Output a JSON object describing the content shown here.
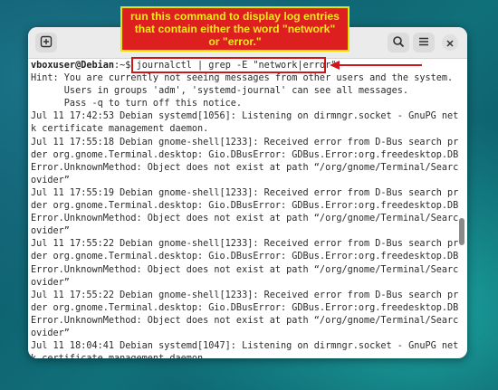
{
  "window": {
    "new_tab_icon": "new-tab-icon",
    "search_icon": "search-icon",
    "menu_icon": "hamburger-menu-icon",
    "close_icon": "close-icon"
  },
  "terminal": {
    "prompt_user": "vboxuser@Debian",
    "prompt_path": ":~$ ",
    "command": "journalctl | grep -E \"network|error\"",
    "lines": [
      "Hint: You are currently not seeing messages from other users and the system.",
      "      Users in groups 'adm', 'systemd-journal' can see all messages.",
      "      Pass -q to turn off this notice.",
      "Jul 11 17:42:53 Debian systemd[1056]: Listening on dirmngr.socket - GnuPG networ",
      "k certificate management daemon.",
      "Jul 11 17:55:18 Debian gnome-shell[1233]: Received error from D-Bus search provi",
      "der org.gnome.Terminal.desktop: Gio.DBusError: GDBus.Error:org.freedesktop.DBus.",
      "Error.UnknownMethod: Object does not exist at path “/org/gnome/Terminal/SearchPr",
      "ovider”",
      "Jul 11 17:55:19 Debian gnome-shell[1233]: Received error from D-Bus search provi",
      "der org.gnome.Terminal.desktop: Gio.DBusError: GDBus.Error:org.freedesktop.DBus.",
      "Error.UnknownMethod: Object does not exist at path “/org/gnome/Terminal/SearchPr",
      "ovider”",
      "Jul 11 17:55:22 Debian gnome-shell[1233]: Received error from D-Bus search provi",
      "der org.gnome.Terminal.desktop: Gio.DBusError: GDBus.Error:org.freedesktop.DBus.",
      "Error.UnknownMethod: Object does not exist at path “/org/gnome/Terminal/SearchPr",
      "ovider”",
      "Jul 11 17:55:22 Debian gnome-shell[1233]: Received error from D-Bus search provi",
      "der org.gnome.Terminal.desktop: Gio.DBusError: GDBus.Error:org.freedesktop.DBus.",
      "Error.UnknownMethod: Object does not exist at path “/org/gnome/Terminal/SearchPr",
      "ovider”",
      "Jul 11 18:04:41 Debian systemd[1047]: Listening on dirmngr.socket - GnuPG networ",
      "k certificate management daemon."
    ]
  },
  "annotation": {
    "callout_lines": [
      "run this command to display log entries",
      "that contain either the word \"network\"",
      "or \"error.\""
    ],
    "callout_bg": "#dd1f1f",
    "callout_text_color": "#f5e91c",
    "highlight_color": "#d0161b"
  }
}
